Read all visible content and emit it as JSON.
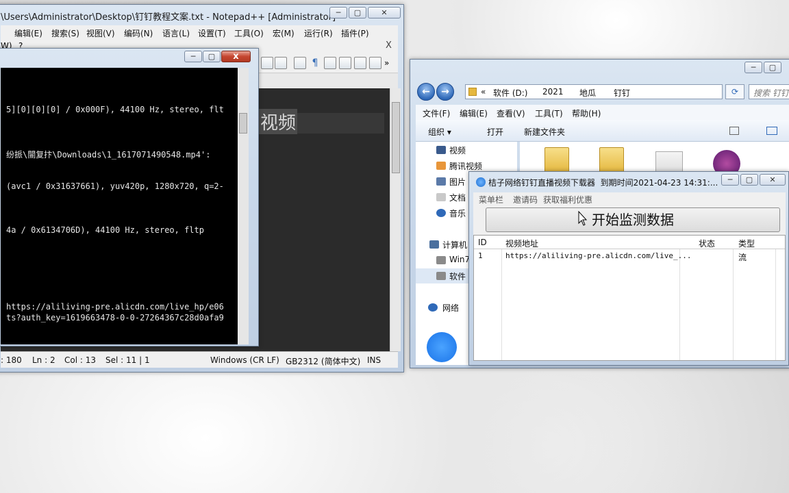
{
  "notepad": {
    "title": "\\Users\\Administrator\\Desktop\\钉钉教程文案.txt - Notepad++ [Administrator]",
    "menu": [
      "编辑(E)",
      "搜索(S)",
      "视图(V)",
      "编码(N)",
      "语言(L)",
      "设置(T)",
      "工具(O)",
      "宏(M)",
      "运行(R)",
      "插件(P)"
    ],
    "menu2": [
      "W)",
      "?"
    ],
    "close_x": "X",
    "editor_word": "视频",
    "status": {
      "length": ": 180",
      "ln": "Ln : 2",
      "col": "Col : 13",
      "sel": "Sel : 11 | 1",
      "eol": "Windows (CR LF)",
      "encoding": "GB2312 (简体中文)",
      "mode": "INS"
    }
  },
  "console": {
    "lines": [
      "5][0][0][0] / 0x000F), 44100 Hz, stereo, flt",
      "纷挀\\闓复抃\\Downloads\\1_1617071490548.mp4':",
      "(avc1 / 0x31637661), yuv420p, 1280x720, q=2-",
      "4a / 0x6134706D), 44100 Hz, stereo, fltp",
      "https://aliliving-pre.alicdn.com/live_hp/e06",
      "ts?auth_key=1619663478-0-0-27264367c28d0afa9"
    ]
  },
  "explorer": {
    "address": [
      "«",
      "软件 (D:)",
      "2021",
      "地瓜",
      "钉钉"
    ],
    "search_placeholder": "搜索 钉钉",
    "menu": [
      "文件(F)",
      "编辑(E)",
      "查看(V)",
      "工具(T)",
      "帮助(H)"
    ],
    "commands": [
      "组织 ▾",
      "打开",
      "新建文件夹"
    ],
    "tree": [
      "视频",
      "腾讯视频",
      "图片",
      "文档",
      "音乐",
      "计算机",
      "Win7",
      "软件",
      "网络"
    ]
  },
  "downloader": {
    "title": "桔子网络钉钉直播视频下载器",
    "expiry": "到期时间2021-04-23 14:31:...",
    "menu": [
      "菜单栏",
      "邀请码",
      "获取福利优惠"
    ],
    "start_button": "开始监测数据",
    "columns": [
      "ID",
      "视频地址",
      "状态",
      "类型"
    ],
    "rows": [
      {
        "id": "1",
        "url": "https://aliliving-pre.alicdn.com/live_...",
        "status": "",
        "type": "流"
      }
    ]
  },
  "colors": {
    "editor_bg": "#2b2b2b",
    "console_bg": "#000000",
    "close_red": "#c54630"
  }
}
